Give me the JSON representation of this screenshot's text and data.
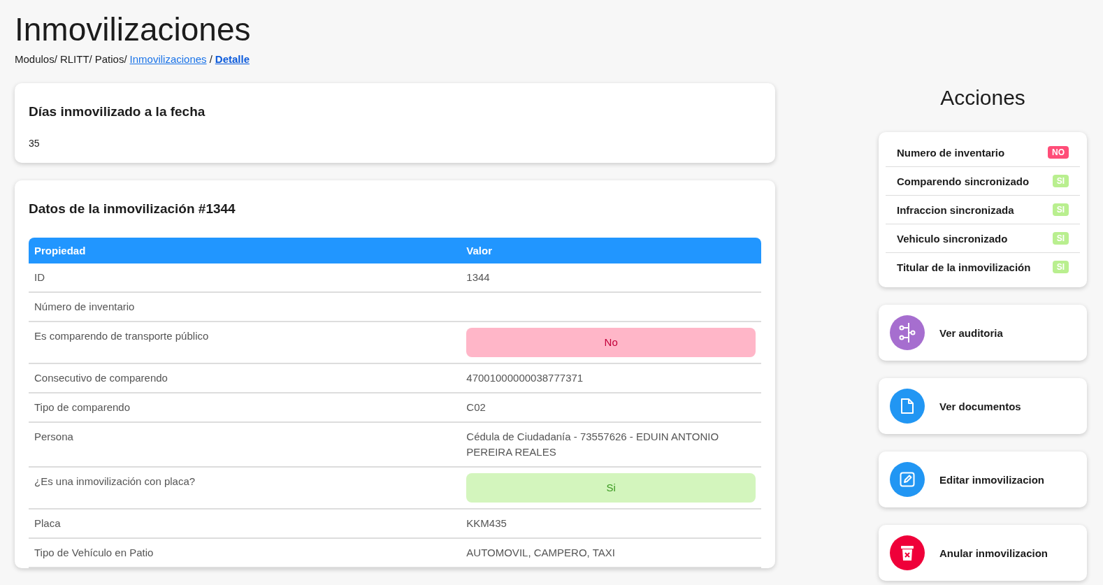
{
  "page": {
    "title": "Inmovilizaciones"
  },
  "breadcrumb": [
    {
      "label": "Modulos/",
      "kind": "plain"
    },
    {
      "label": "RLITT/",
      "kind": "plain"
    },
    {
      "label": "Patios/",
      "kind": "plain"
    },
    {
      "label": "Inmovilizaciones",
      "kind": "link"
    },
    {
      "label": "/",
      "kind": "plain"
    },
    {
      "label": "Detalle",
      "kind": "current"
    }
  ],
  "days_card": {
    "title": "Días inmovilizado a la fecha",
    "value": "35"
  },
  "details_card": {
    "title": "Datos de la inmovilización #1344",
    "table": {
      "columns": [
        "Propiedad",
        "Valor"
      ],
      "rows": [
        {
          "property": "ID",
          "kind": "text",
          "value": "1344"
        },
        {
          "property": "Número de inventario",
          "kind": "text"
        },
        {
          "property": "Es comparendo de transporte público",
          "kind": "status",
          "positive": false,
          "value": "No"
        },
        {
          "property": "Consecutivo de comparendo",
          "kind": "text",
          "value": "47001000000038777371"
        },
        {
          "property": "Tipo de comparendo",
          "kind": "text",
          "value": "C02"
        },
        {
          "property": "Persona",
          "kind": "text",
          "value": "Cédula de Ciudadanía - 73557626 - EDUIN ANTONIO PEREIRA REALES"
        },
        {
          "property": "¿Es una inmovilización con placa?",
          "kind": "status",
          "positive": true,
          "value": "Si"
        },
        {
          "property": "Placa",
          "kind": "text",
          "value": "KKM435"
        },
        {
          "property": "Tipo de Vehículo en Patio",
          "kind": "text",
          "value": "AUTOMOVIL, CAMPERO, TAXI"
        }
      ]
    }
  },
  "actions": {
    "title": "Acciones",
    "checks": [
      {
        "label": "Numero de inventario",
        "positive": false,
        "badge": "NO"
      },
      {
        "label": "Comparendo sincronizado",
        "positive": true,
        "badge": "SI"
      },
      {
        "label": "Infraccion sincronizada",
        "positive": true,
        "badge": "SI"
      },
      {
        "label": "Vehiculo sincronizado",
        "positive": true,
        "badge": "SI"
      },
      {
        "label": "Titular de la inmovilización",
        "positive": true,
        "badge": "SI"
      }
    ],
    "buttons": [
      {
        "label": "Ver auditoria",
        "kind": "audit",
        "color": "#a66ecf"
      },
      {
        "label": "Ver documentos",
        "kind": "documents",
        "color": "#2196f3"
      },
      {
        "label": "Editar inmovilizacion",
        "kind": "edit",
        "color": "#2196f3"
      },
      {
        "label": "Anular inmovilizacion",
        "kind": "delete",
        "color": "#ef0039"
      }
    ]
  }
}
